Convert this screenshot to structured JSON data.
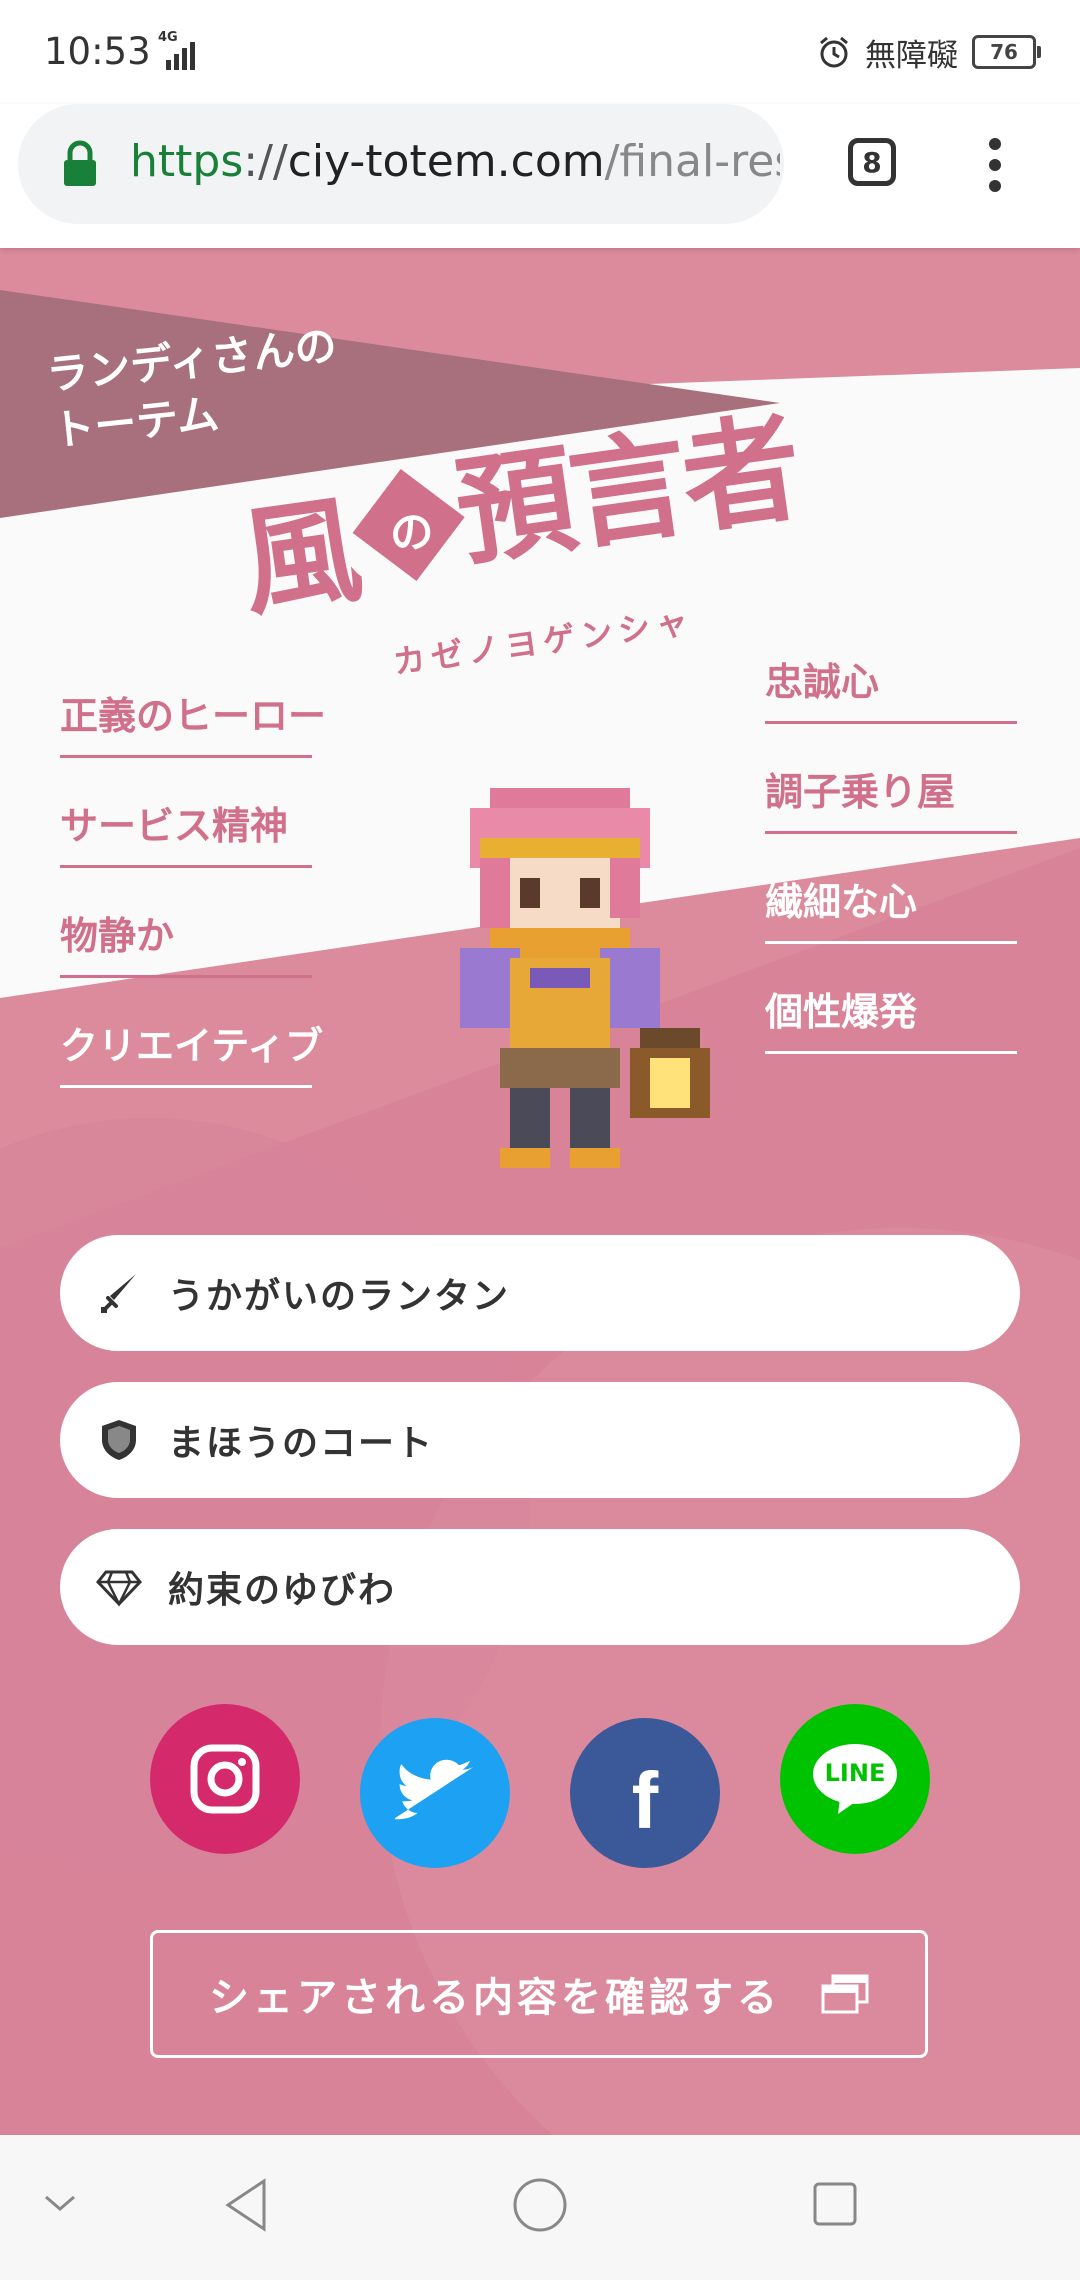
{
  "status_bar": {
    "time": "10:53",
    "network": "4G",
    "carrier": "無障礙",
    "battery": "76"
  },
  "browser": {
    "url_scheme": "https",
    "url_sep": "://",
    "url_host": "ciy-totem.com",
    "url_path": "/final-result",
    "tab_count": "8"
  },
  "result": {
    "totem_label": "ランディさんのトーテム",
    "title_part1": "風",
    "title_no": "の",
    "title_part2": "預言者",
    "reading": "カゼノヨゲンシャ",
    "traits_left": [
      "正義のヒーロー",
      "サービス精神",
      "物静か",
      "クリエイティブ"
    ],
    "traits_right": [
      "忠誠心",
      "調子乗り屋",
      "繊細な心",
      "個性爆発"
    ]
  },
  "items": [
    {
      "label": "うかがいのランタン",
      "icon": "sword-icon"
    },
    {
      "label": "まほうのコート",
      "icon": "shield-icon"
    },
    {
      "label": "約束のゆびわ",
      "icon": "diamond-icon"
    }
  ],
  "sns": {
    "instagram_color": "#d42a6b",
    "twitter_color": "#1da1f2",
    "facebook_color": "#3b5998",
    "line_color": "#00c300",
    "line_text": "LINE",
    "facebook_text": "f"
  },
  "share_button": {
    "label": "シェアされる内容を確認する"
  },
  "colors": {
    "background_pink": "#db8b9c",
    "accent_pink": "#d0708a",
    "banner_dark": "#a8707c"
  }
}
